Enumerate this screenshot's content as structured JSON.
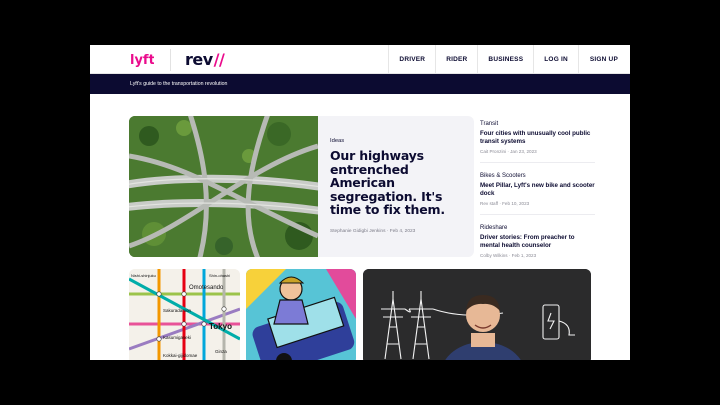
{
  "nav": {
    "brand_lyft": "lyft",
    "brand_rev": "rev",
    "brand_rev_mark": "//",
    "items": [
      "DRIVER",
      "RIDER",
      "BUSINESS",
      "LOG IN",
      "SIGN UP"
    ]
  },
  "tagline": "Lyft's guide to the transportation revolution",
  "feature": {
    "category": "Ideas",
    "headline": "Our highways entrenched American segregation. It's time to fix them.",
    "byline": "Stephanie Gidigbi Jenkins · Feb 4, 2023"
  },
  "rail": [
    {
      "category": "Transit",
      "title": "Four cities with unusually cool public transit systems",
      "meta": "Cait Pronzini · Jan 23, 2023"
    },
    {
      "category": "Bikes & Scooters",
      "title": "Meet Pillar, Lyft's new bike and scooter dock",
      "meta": "Rev staff · Feb 10, 2023"
    },
    {
      "category": "Rideshare",
      "title": "Driver stories: From preacher to mental health counselor",
      "meta": "Colby Wilkins · Feb 1, 2023"
    }
  ],
  "map_labels": [
    "Omotesando",
    "Tokyo",
    "Sakuradamon",
    "Kasumigaseki",
    "Kokkai-gijidomae",
    "Ginza",
    "Nishi-shinjuku",
    "Shin-ohashi"
  ],
  "colors": {
    "navy": "#0c0b31",
    "magenta": "#ea0b8c"
  }
}
